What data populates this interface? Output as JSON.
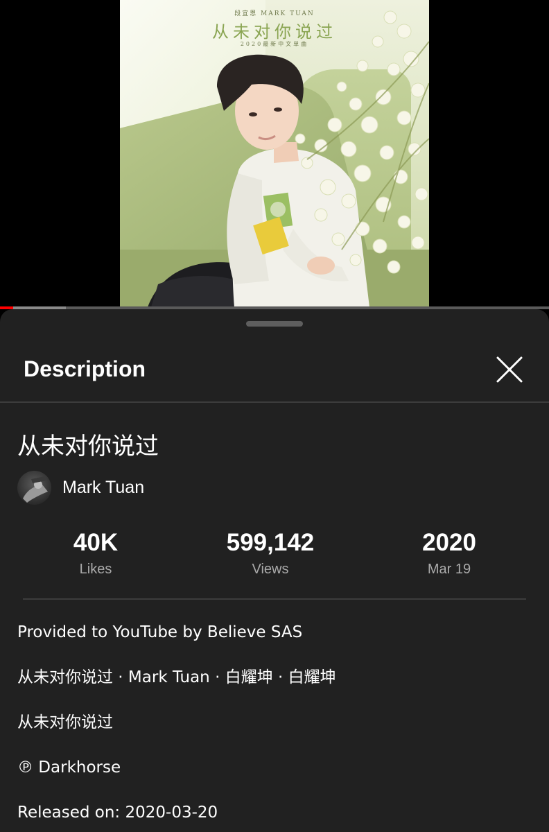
{
  "video": {
    "poster": {
      "artist_line": "段宜恩 MARK TUAN",
      "title": "从未对你说过",
      "subtitle": "2020最新中文单曲"
    },
    "progress": {
      "played_fraction": 0.024,
      "buffered_fraction": 0.12
    },
    "colors": {
      "played": "#ff0000",
      "buffered": "#8a8a8a",
      "track": "#5a5a5a"
    }
  },
  "sheet": {
    "title": "Description",
    "close_icon": "close-icon"
  },
  "video_info": {
    "title": "从未对你说过",
    "channel_name": "Mark Tuan"
  },
  "stats": [
    {
      "value": "40K",
      "label": "Likes"
    },
    {
      "value": "599,142",
      "label": "Views"
    },
    {
      "value": "2020",
      "label": "Mar 19"
    }
  ],
  "description": {
    "lines": [
      "Provided to YouTube by Believe SAS",
      "从未对你说过 · Mark Tuan · 白耀坤 · 白耀坤",
      "从未对你说过",
      "℗ Darkhorse",
      "Released on: 2020-03-20"
    ]
  }
}
